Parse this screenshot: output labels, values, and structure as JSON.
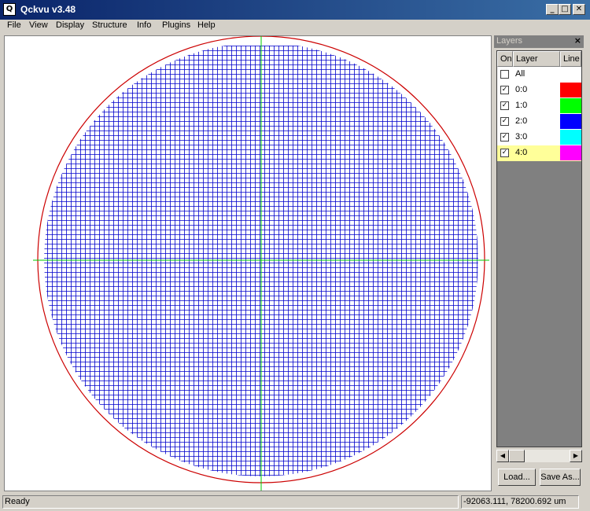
{
  "window": {
    "title": "Qckvu v3.48",
    "icon": "app-logo-icon",
    "controls": [
      "_",
      "□",
      "✕"
    ]
  },
  "menu": {
    "items": [
      "File",
      "View",
      "Display",
      "Structure",
      "Info",
      "Plugins",
      "Help"
    ]
  },
  "layers_panel": {
    "title": "Layers",
    "close_glyph": "×",
    "headers": {
      "on": "On",
      "layer": "Layer",
      "line": "Line"
    },
    "rows": [
      {
        "name": "All",
        "checked": false,
        "color": "#ffffff",
        "selected": false
      },
      {
        "name": "0:0",
        "checked": true,
        "color": "#ff0000",
        "selected": false
      },
      {
        "name": "1:0",
        "checked": true,
        "color": "#00ff00",
        "selected": false
      },
      {
        "name": "2:0",
        "checked": true,
        "color": "#0000ff",
        "selected": false
      },
      {
        "name": "3:0",
        "checked": true,
        "color": "#00ffff",
        "selected": false
      },
      {
        "name": "4:0",
        "checked": true,
        "color": "#ff00ff",
        "selected": true
      }
    ],
    "load_label": "Load...",
    "save_label": "Save As..."
  },
  "canvas": {
    "wafer_outline_color": "#cc0000",
    "die_grid_color": "#0000cc",
    "crosshair_color": "#00cc00"
  },
  "status": {
    "text": "Ready",
    "coordinates": "-92063.111, 78200.692 um"
  }
}
